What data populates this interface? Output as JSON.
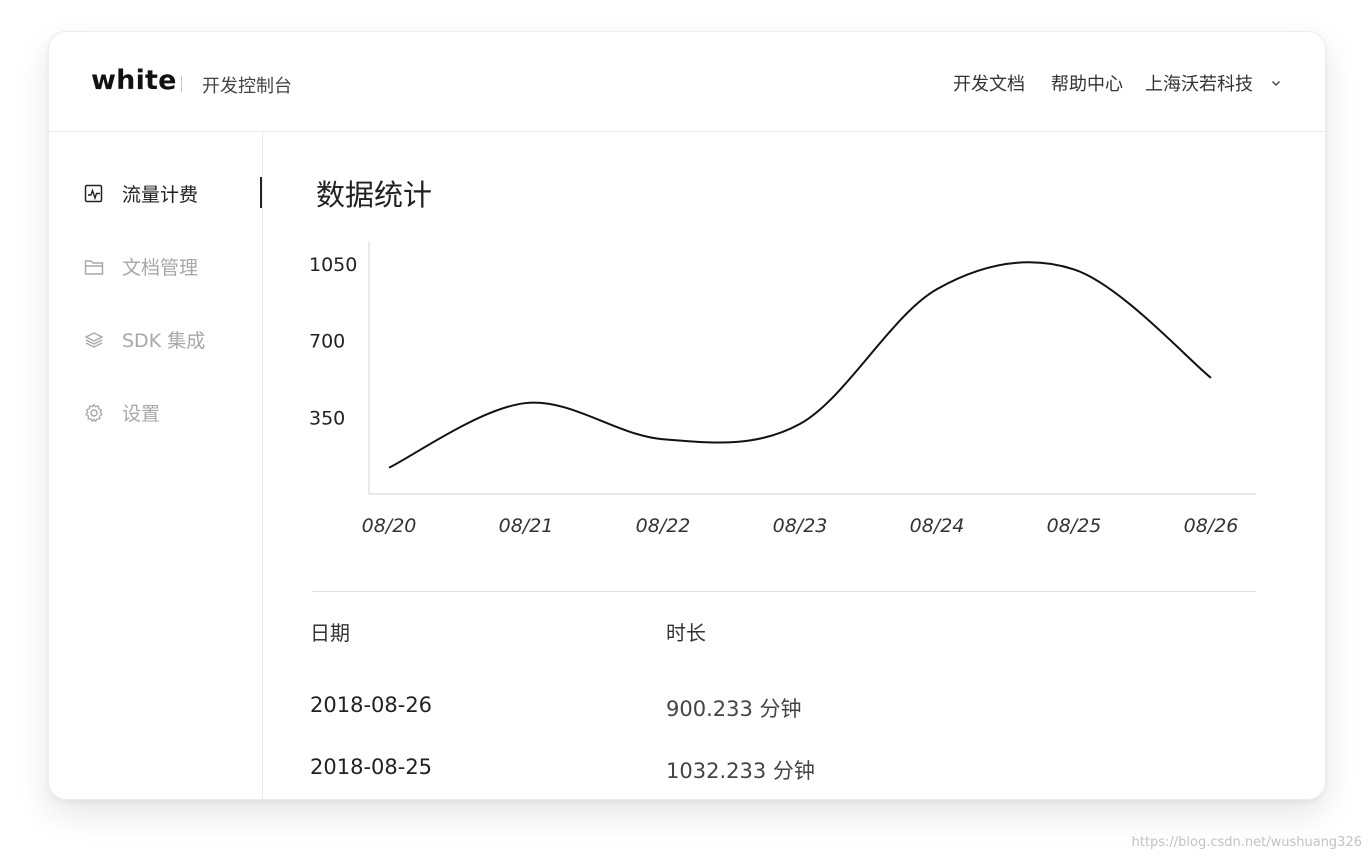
{
  "header": {
    "logo": "white",
    "subtitle": "开发控制台",
    "links": [
      "开发文档",
      "帮助中心"
    ],
    "company": "上海沃若科技"
  },
  "sidebar": {
    "items": [
      {
        "label": "流量计费",
        "icon": "activity-chart-icon",
        "active": true
      },
      {
        "label": "文档管理",
        "icon": "folder-icon",
        "active": false
      },
      {
        "label": "SDK 集成",
        "icon": "layers-icon",
        "active": false
      },
      {
        "label": "设置",
        "icon": "gear-icon",
        "active": false
      }
    ]
  },
  "main": {
    "title": "数据统计"
  },
  "chart_data": {
    "type": "line",
    "smooth": true,
    "categories": [
      "08/20",
      "08/21",
      "08/22",
      "08/23",
      "08/24",
      "08/25",
      "08/26"
    ],
    "values": [
      120,
      415,
      250,
      320,
      935,
      1025,
      530
    ],
    "y_ticks": [
      350,
      700,
      1050
    ],
    "ylim": [
      0,
      1150
    ],
    "grid": false,
    "color": "#111111"
  },
  "table": {
    "headers": [
      "日期",
      "时长"
    ],
    "rows": [
      [
        "2018-08-26",
        "900.233 分钟"
      ],
      [
        "2018-08-25",
        "1032.233 分钟"
      ]
    ]
  },
  "watermark": "https://blog.csdn.net/wushuang326"
}
